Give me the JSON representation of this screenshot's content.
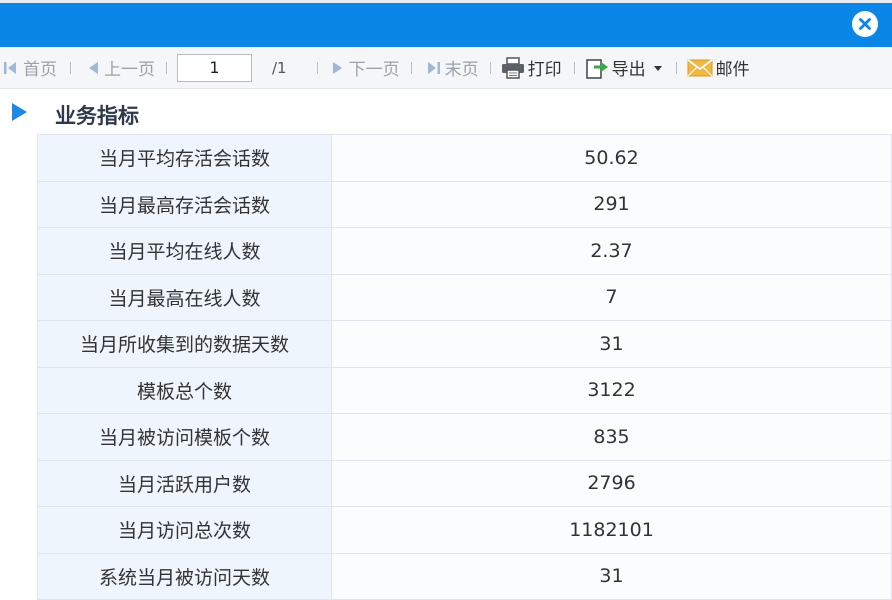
{
  "window": {
    "close_icon": "close-circle-icon",
    "title_bar_color": "#0a86e6"
  },
  "toolbar": {
    "first_label": "首页",
    "prev_label": "上一页",
    "page_value": "1",
    "page_total": "/1",
    "next_label": "下一页",
    "last_label": "末页",
    "print_label": "打印",
    "export_label": "导出",
    "mail_label": "邮件"
  },
  "section": {
    "title": "业务指标"
  },
  "metrics": [
    {
      "label": "当月平均存活会话数",
      "value": "50.62"
    },
    {
      "label": "当月最高存活会话数",
      "value": "291"
    },
    {
      "label": "当月平均在线人数",
      "value": "2.37"
    },
    {
      "label": "当月最高在线人数",
      "value": "7"
    },
    {
      "label": "当月所收集到的数据天数",
      "value": "31"
    },
    {
      "label": "模板总个数",
      "value": "3122"
    },
    {
      "label": "当月被访问模板个数",
      "value": "835"
    },
    {
      "label": "当月活跃用户数",
      "value": "2796"
    },
    {
      "label": "当月访问总次数",
      "value": "1182101"
    },
    {
      "label": "系统当月被访问天数",
      "value": "31"
    }
  ]
}
